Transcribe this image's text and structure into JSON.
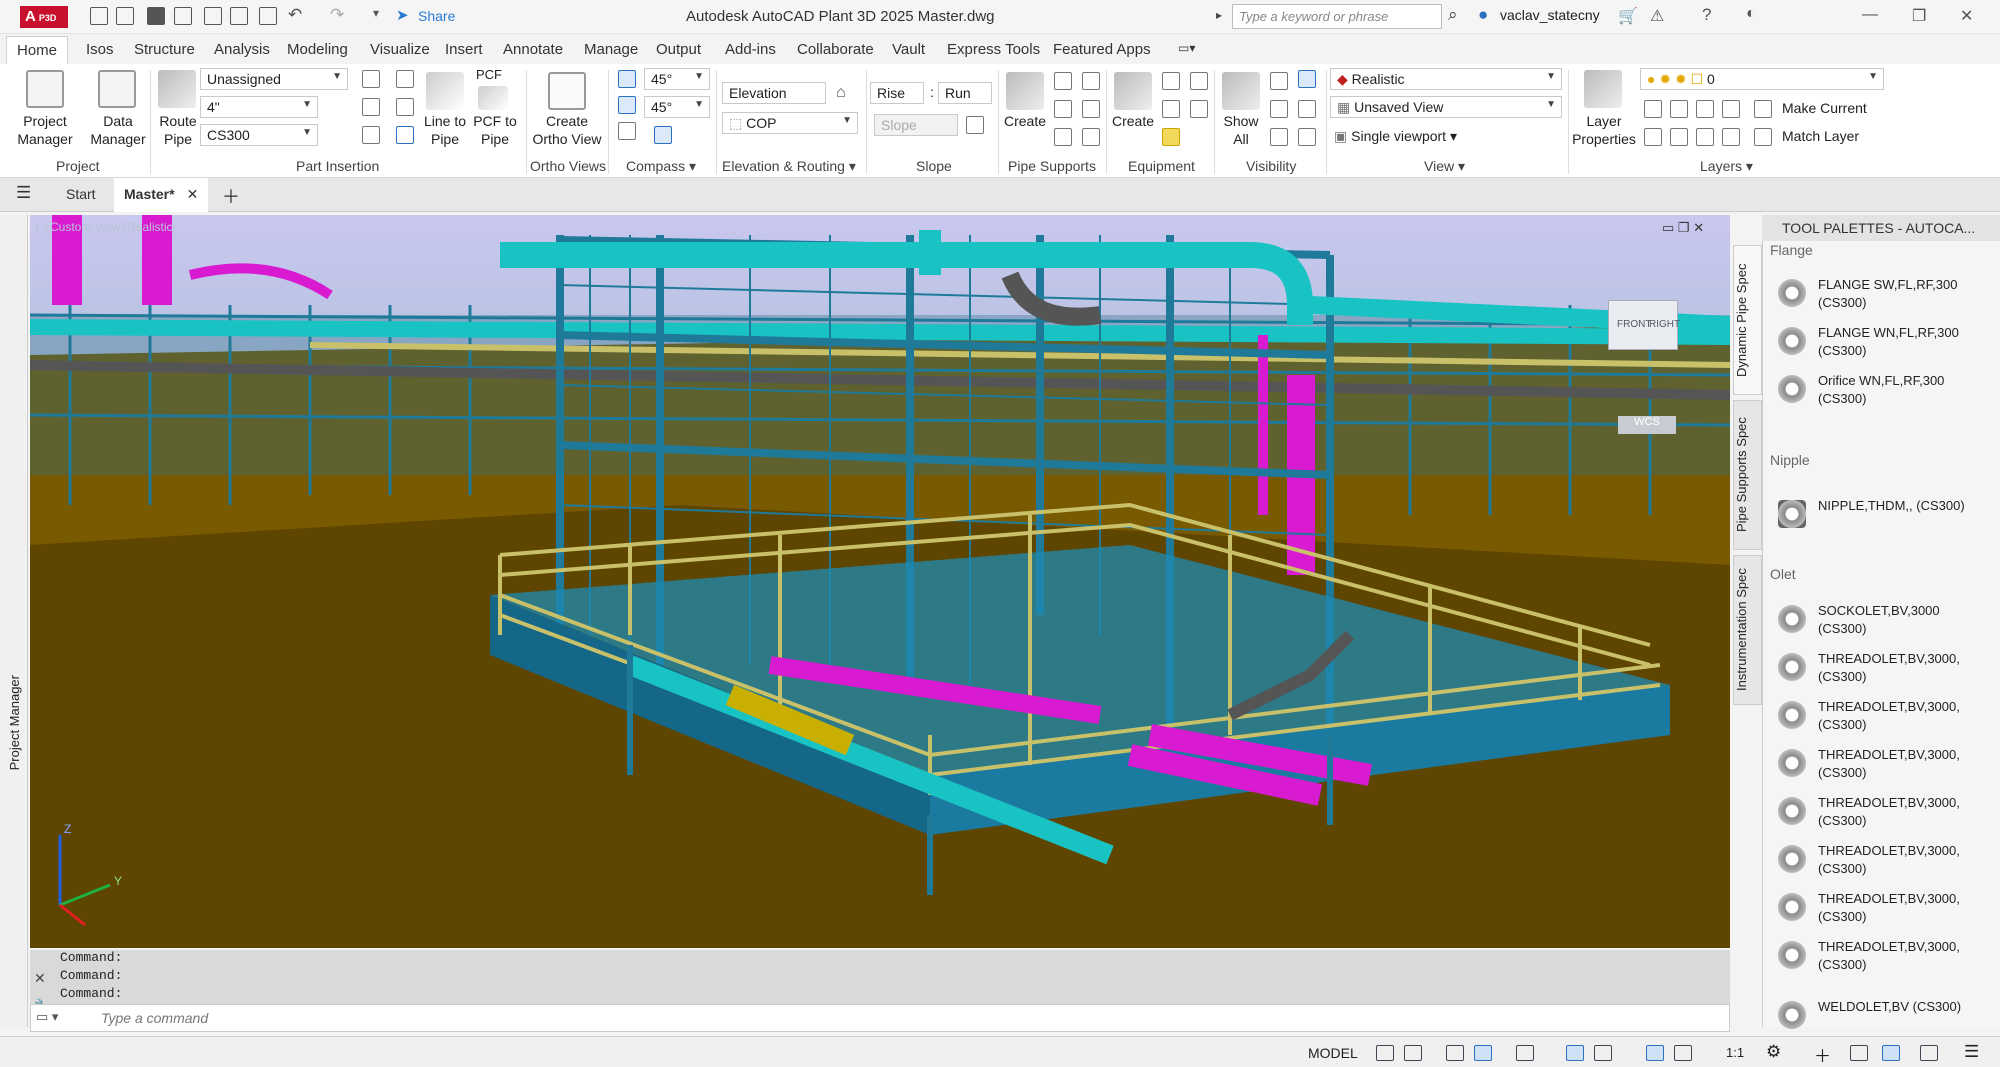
{
  "app": {
    "logo": "A",
    "logo_sub": "P3D",
    "title": "Autodesk AutoCAD Plant 3D 2025    Master.dwg",
    "share": "Share",
    "search_placeholder": "Type a keyword or phrase",
    "user": "vaclav_statecny"
  },
  "tabs": [
    "Home",
    "Isos",
    "Structure",
    "Analysis",
    "Modeling",
    "Visualize",
    "Insert",
    "Annotate",
    "Manage",
    "Output",
    "Add-ins",
    "Collaborate",
    "Vault",
    "Express Tools",
    "Featured Apps"
  ],
  "ribbon": {
    "project": {
      "title": "Project",
      "project_manager": "Project Manager",
      "data_manager": "Data Manager"
    },
    "part_insertion": {
      "title": "Part Insertion",
      "route_pipe": "Route Pipe",
      "service": "Unassigned",
      "size": "4\"",
      "spec": "CS300",
      "line_to_pipe": "Line to Pipe",
      "pcf_to_pipe": "PCF to Pipe",
      "pcf": "PCF"
    },
    "ortho": {
      "title": "Ortho Views",
      "create": "Create Ortho View"
    },
    "compass": {
      "title": "Compass",
      "angle1": "45°",
      "angle2": "45°"
    },
    "elevation": {
      "title": "Elevation & Routing",
      "elevation": "Elevation",
      "cop": "COP"
    },
    "slope": {
      "title": "Slope",
      "rise": "Rise",
      "run": "Run",
      "slope": "Slope",
      "colon": ":"
    },
    "pipe_supports": {
      "title": "Pipe Supports",
      "create": "Create"
    },
    "equipment": {
      "title": "Equipment",
      "create": "Create"
    },
    "visibility": {
      "title": "Visibility",
      "show_all": "Show All"
    },
    "view": {
      "title": "View",
      "visual_style": "Realistic",
      "named_view": "Unsaved View",
      "viewport": "Single viewport"
    },
    "layers": {
      "title": "Layers",
      "layer_properties": "Layer Properties",
      "current_layer": "0",
      "make_current": "Make Current",
      "match_layer": "Match Layer"
    }
  },
  "doc_tabs": {
    "start": "Start",
    "master": "Master*"
  },
  "viewport": {
    "label": "[-][Custom View][Realistic]",
    "viewcube_front": "FRONT",
    "viewcube_right": "RIGHT",
    "wcs": "WCS",
    "axis_z": "Z",
    "axis_y": "Y"
  },
  "left_panel": {
    "label": "Project Manager"
  },
  "palette": {
    "header": "TOOL PALETTES - AUTOCA...",
    "side_tabs": [
      "Dynamic Pipe Spec",
      "Pipe Supports Spec",
      "Instrumentation Spec"
    ],
    "sections": [
      {
        "name": "Flange",
        "items": [
          "FLANGE SW,FL,RF,300 (CS300)",
          "FLANGE WN,FL,RF,300 (CS300)",
          "Orifice WN,FL,RF,300 (CS300)"
        ]
      },
      {
        "name": "Nipple",
        "items": [
          "NIPPLE,THDM,, (CS300)"
        ]
      },
      {
        "name": "Olet",
        "items": [
          "SOCKOLET,BV,3000 (CS300)",
          "THREADOLET,BV,3000, (CS300)",
          "THREADOLET,BV,3000, (CS300)",
          "THREADOLET,BV,3000, (CS300)",
          "THREADOLET,BV,3000, (CS300)",
          "THREADOLET,BV,3000, (CS300)",
          "THREADOLET,BV,3000, (CS300)",
          "THREADOLET,BV,3000, (CS300)",
          "WELDOLET,BV (CS300)"
        ]
      }
    ]
  },
  "command": {
    "history": [
      "Command:",
      "Command:",
      "Command:"
    ],
    "placeholder": "Type a command"
  },
  "status": {
    "model": "MODEL",
    "scale": "1:1"
  },
  "colors": {
    "accent": "#2a7bd4",
    "pipe_cyan": "#19c3c3",
    "pipe_magenta": "#d81bd0",
    "steel": "#1f7a9a",
    "ground": "#7a5a00",
    "rail_yellow": "#c9c06a"
  }
}
